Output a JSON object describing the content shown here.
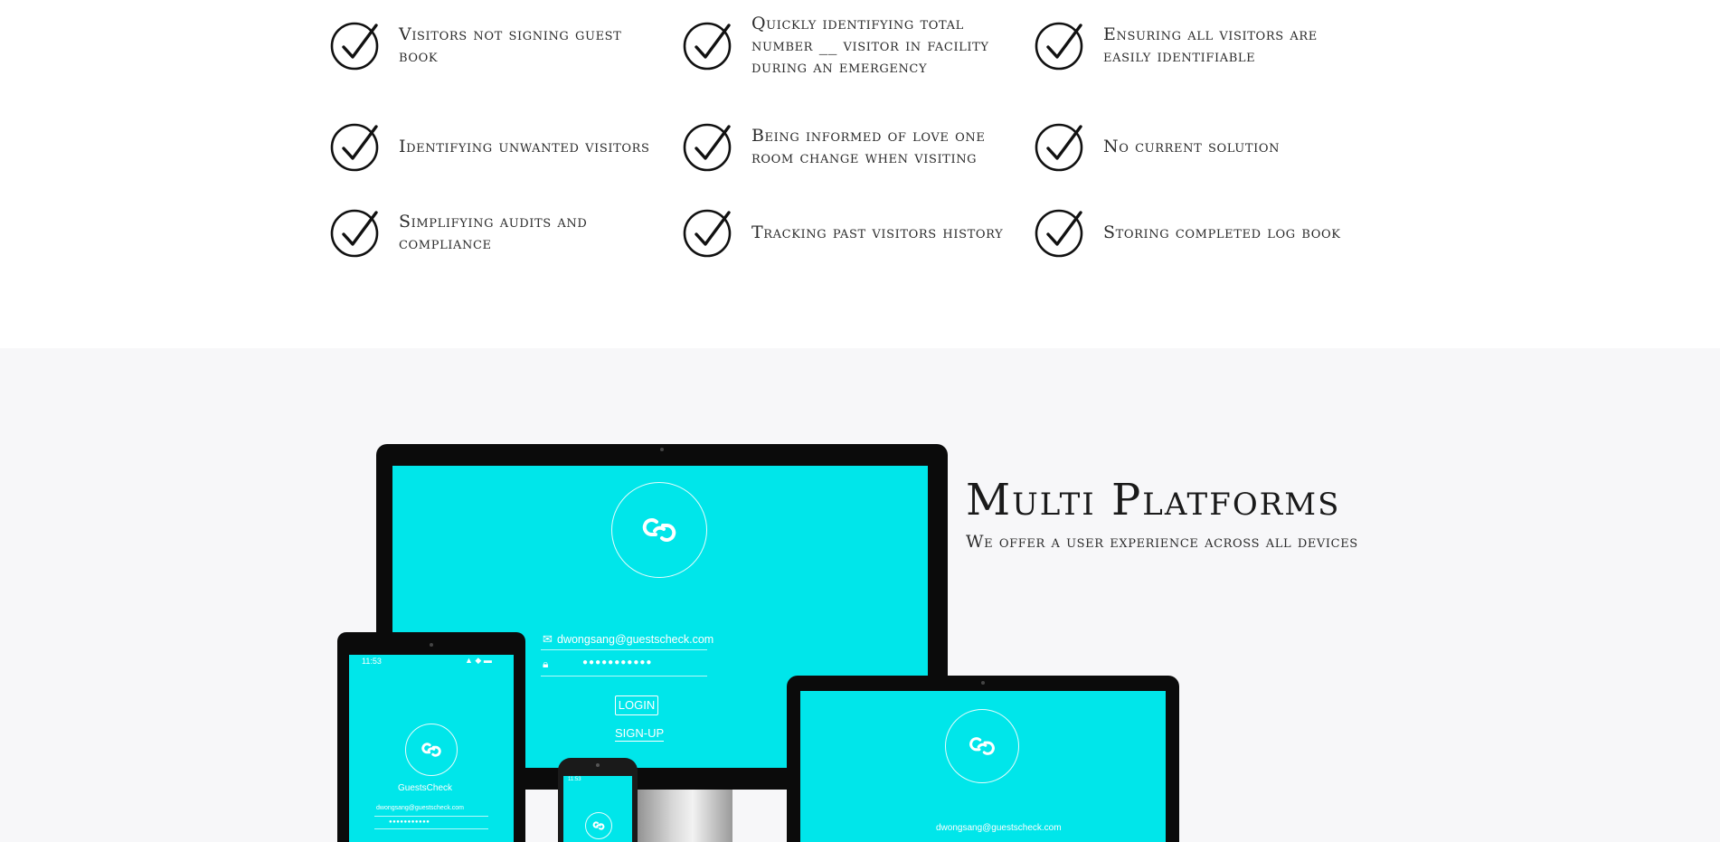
{
  "features": {
    "items": [
      {
        "text": "Visitors not signing guest book"
      },
      {
        "text": "Quickly identifying total number __ visitor in facility during an emergency"
      },
      {
        "text": "Ensuring all visitors are easily identifiable"
      },
      {
        "text": "Identifying unwanted visitors"
      },
      {
        "text": "Being informed of love one room change when visiting"
      },
      {
        "text": "No current solution"
      },
      {
        "text": "Simplifying audits and compliance"
      },
      {
        "text": "Tracking past visitors history"
      },
      {
        "text": "Storing completed log book"
      }
    ],
    "icon": "check-circle-icon"
  },
  "platforms": {
    "title": "Multi Platforms",
    "subtitle": "We offer a user experience across all devices"
  },
  "mockup": {
    "email": "dwongsang@guestscheck.com",
    "password_mask": "●●●●●●●●●●●",
    "login_label": "LOGIN",
    "signup_label": "SIGN-UP",
    "app_name": "GuestsCheck",
    "status_time_tablet": "11:53",
    "status_time_phone": "11:53",
    "screen_color": "#00e6ea"
  },
  "colors": {
    "page_bg": "#ffffff",
    "section_bg": "#f7f7f9",
    "accent": "#00e6ea",
    "text": "#2b2b2b"
  }
}
